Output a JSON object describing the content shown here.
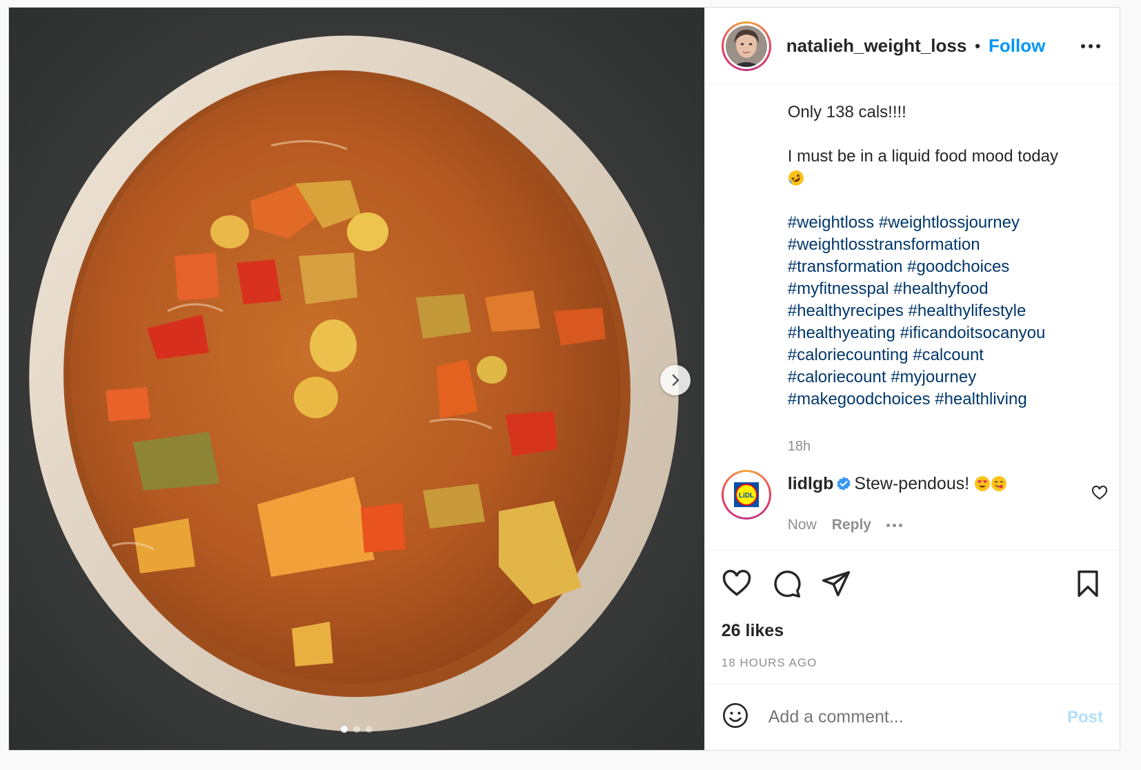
{
  "post": {
    "username": "natalieh_weight_loss",
    "follow_label": "Follow",
    "separator": "•",
    "caption": {
      "line1": "Only 138 cals!!!!",
      "line2": "I must be in a liquid food mood today",
      "emoji": "rolling-on-floor-laughing-emoji",
      "hashtag_lines": [
        [
          "#weightloss",
          "#weightlossjourney"
        ],
        [
          "#weightlosstransformation"
        ],
        [
          "#transformation",
          "#goodchoices"
        ],
        [
          "#myfitnesspal",
          "#healthyfood"
        ],
        [
          "#healthyrecipes",
          "#healthylifestyle"
        ],
        [
          "#healthyeating",
          "#ificandoitsocanyou"
        ],
        [
          "#caloriecounting",
          "#calcount"
        ],
        [
          "#caloriecount",
          "#myjourney"
        ],
        [
          "#makegoodchoices",
          "#healthliving"
        ]
      ],
      "time": "18h"
    },
    "comment": {
      "author": "lidlgb",
      "text": "Stew-pendous!",
      "emojis": [
        "heart-eyes-emoji",
        "yum-emoji"
      ],
      "time": "Now",
      "reply_label": "Reply",
      "avatar_text": "LiDL"
    },
    "likes": "26 likes",
    "posted_ago": "18 HOURS AGO",
    "add_comment": {
      "placeholder": "Add a comment...",
      "post_label": "Post"
    },
    "carousel": {
      "count": 3,
      "active": 0
    },
    "colors": {
      "link_blue": "#0095f6",
      "hashtag": "#00376b",
      "muted": "#8e8e8e",
      "post_disabled": "#b2dffc"
    }
  }
}
